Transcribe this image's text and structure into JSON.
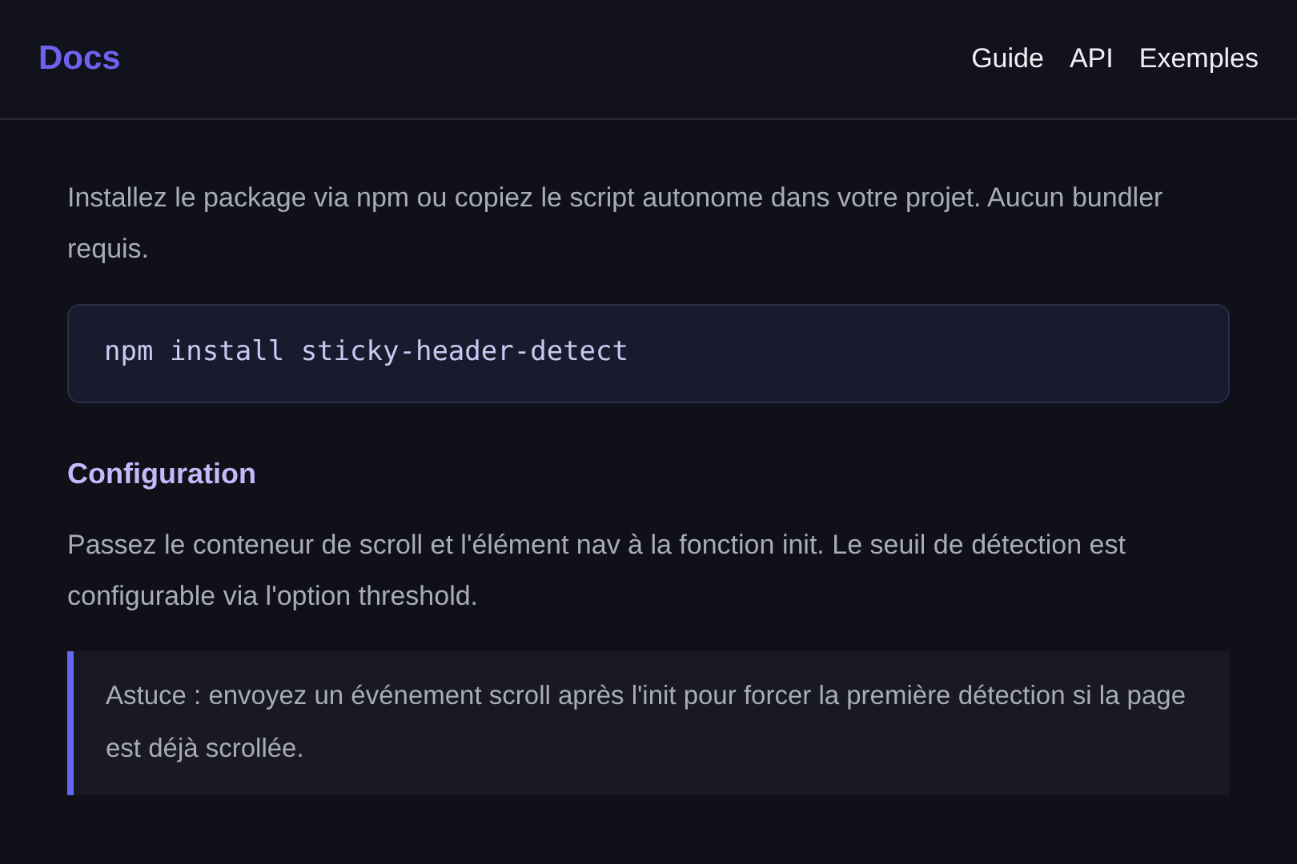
{
  "header": {
    "brand": "Docs",
    "links": [
      {
        "label": "Guide"
      },
      {
        "label": "API"
      },
      {
        "label": "Exemples"
      }
    ]
  },
  "content": [
    {
      "kind": "paragraph",
      "text": "Installez le package via npm ou copiez le script autonome dans votre projet. Aucun bundler requis."
    },
    {
      "kind": "code",
      "text": "npm install sticky-header-detect"
    },
    {
      "kind": "heading",
      "text": "Configuration"
    },
    {
      "kind": "paragraph",
      "text": "Passez le conteneur de scroll et l'élément nav à la fonction init. Le seuil de détection est configurable via l'option threshold."
    },
    {
      "kind": "callout",
      "text": "Astuce : envoyez un événement scroll après l'init pour forcer la première détection si la page est déjà scrollée."
    }
  ]
}
